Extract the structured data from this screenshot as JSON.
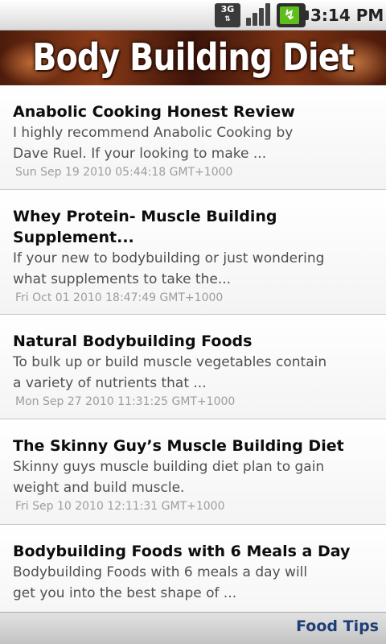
{
  "status_bar": {
    "network": "3G",
    "time": "3:14 PM",
    "icons": [
      "3g-network-icon",
      "signal-bars-icon",
      "battery-charging-icon"
    ]
  },
  "header": {
    "title": "Body Building Diet"
  },
  "articles": [
    {
      "title": "Anabolic Cooking Honest Review",
      "summary_lines": [
        "I highly recommend Anabolic Cooking by",
        "Dave Ruel. If your looking to make ..."
      ],
      "date": "Sun Sep 19 2010 05:44:18 GMT+1000"
    },
    {
      "title_lines": [
        "Whey Protein- Muscle Building",
        "Supplement..."
      ],
      "summary_lines": [
        "If your new to bodybuilding or just wondering",
        "what supplements to take the..."
      ],
      "date": "Fri Oct 01 2010 18:47:49 GMT+1000"
    },
    {
      "title": "Natural Bodybuilding Foods",
      "summary_lines": [
        "To bulk up or build muscle vegetables contain",
        "a variety of nutrients that ..."
      ],
      "date": "Mon Sep 27 2010 11:31:25 GMT+1000"
    },
    {
      "title": "The Skinny Guy’s Muscle Building Diet",
      "summary_lines": [
        "Skinny guys muscle building diet plan to gain",
        "weight and build muscle."
      ],
      "date": "Fri Sep 10 2010 12:11:31 GMT+1000"
    },
    {
      "title": "Bodybuilding Foods with 6 Meals a Day",
      "summary_lines": [
        "Bodybuilding Foods with 6 meals a day will",
        "get you into the best shape of ..."
      ],
      "date": ""
    }
  ],
  "bottom_bar": {
    "food_tips_label": "Food Tips"
  },
  "colors": {
    "link": "#1f3e77",
    "title_text": "#0d0d0d",
    "summary_text": "#505050",
    "date_text": "#9d9d9d"
  }
}
